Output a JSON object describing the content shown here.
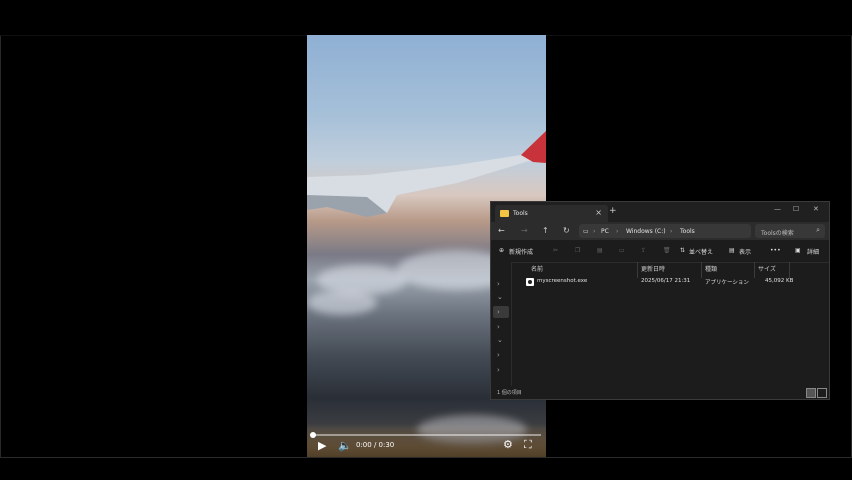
{
  "video": {
    "time": "0:00 / 0:30",
    "progress": 0.0
  },
  "explorer": {
    "tab_title": "Tools",
    "breadcrumb": [
      "PC",
      "Windows (C:)",
      "Tools"
    ],
    "search_placeholder": "Toolsの検索",
    "toolbar": {
      "new": "新規作成",
      "sort": "並べ替え",
      "view": "表示",
      "more": "•••",
      "details": "詳細"
    },
    "columns": [
      "名前",
      "更新日時",
      "種類",
      "サイズ"
    ],
    "files": [
      {
        "name": "myscreenshot.exe",
        "modified": "2025/06/17 21:31",
        "type": "アプリケーション",
        "size": "45,092 KB"
      }
    ],
    "status": "1 個の項目"
  },
  "colors": {
    "explorer_bg": "#1c1c1c",
    "folder": "#f4c542",
    "accent": "#0078d4"
  }
}
